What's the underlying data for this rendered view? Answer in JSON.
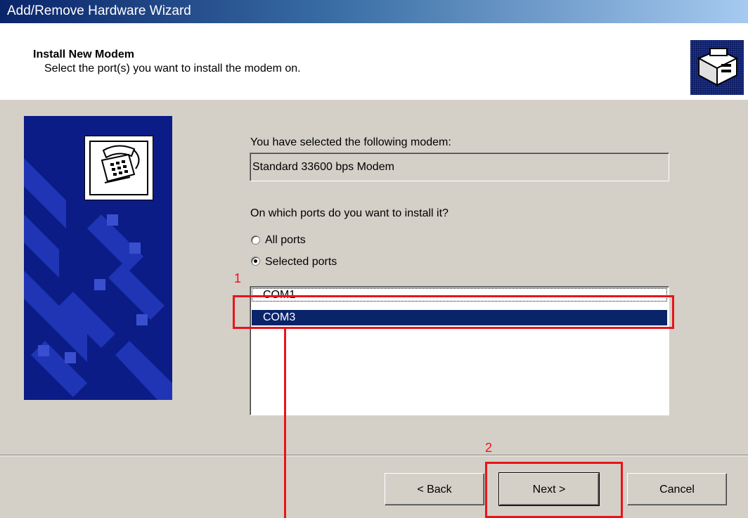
{
  "window": {
    "title": "Add/Remove Hardware Wizard"
  },
  "header": {
    "title": "Install New Modem",
    "subtitle": "Select the port(s) you want to install the modem on.",
    "icon": "hardware-install-icon"
  },
  "side_panel": {
    "icon": "telephone-icon"
  },
  "modem": {
    "label": "You have selected the following modem:",
    "value": "Standard 33600 bps Modem"
  },
  "ports": {
    "question": "On which ports do you want to install it?",
    "options": [
      {
        "label": "All ports",
        "selected": false
      },
      {
        "label": "Selected ports",
        "selected": true
      }
    ],
    "list": [
      {
        "label": "COM1",
        "selected": false
      },
      {
        "label": "COM3",
        "selected": true
      }
    ]
  },
  "buttons": {
    "back": "< Back",
    "next": "Next >",
    "cancel": "Cancel"
  },
  "annotations": {
    "step1": "1",
    "step2": "2",
    "color": "#e8141a"
  }
}
